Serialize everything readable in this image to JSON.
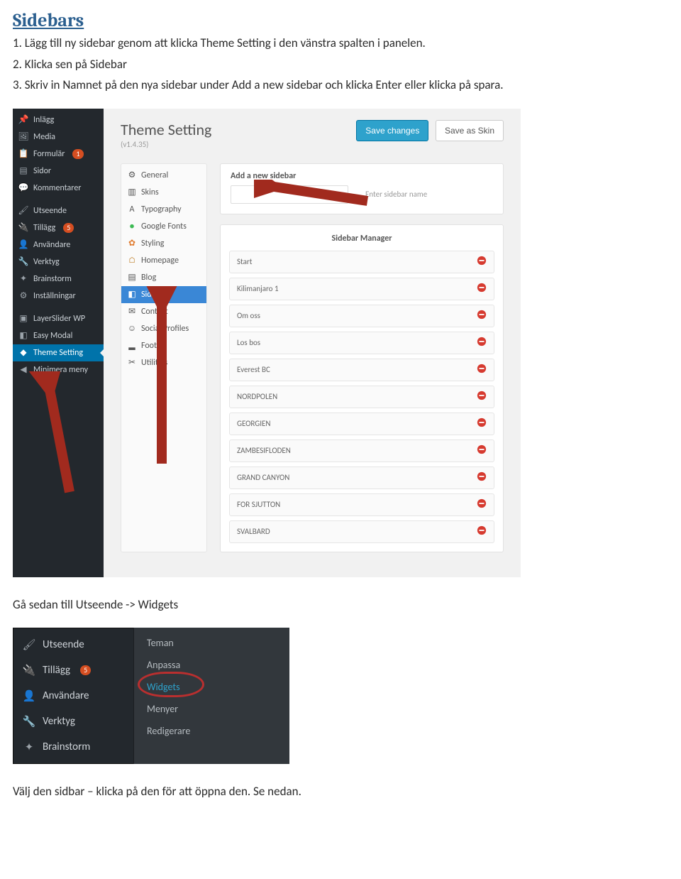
{
  "heading": "Sidebars",
  "steps": {
    "s1": "1. Lägg till ny sidebar genom att klicka Theme Setting i den vänstra spalten i panelen.",
    "s2": "2. Klicka sen på Sidebar",
    "s3": "3. Skriv in Namnet på den nya sidebar under Add a new sidebar och klicka Enter eller klicka på spara."
  },
  "mid_text": "Gå sedan till Utseende -> Widgets",
  "end_text": "Välj den sidbar – klicka på den för att öppna den. Se nedan.",
  "shot1": {
    "wp_menu": [
      {
        "label": "Inlägg",
        "badge": "",
        "icon": "pin"
      },
      {
        "label": "Media",
        "badge": "",
        "icon": "media"
      },
      {
        "label": "Formulär",
        "badge": "1",
        "icon": "form"
      },
      {
        "label": "Sidor",
        "badge": "",
        "icon": "page"
      },
      {
        "label": "Kommentarer",
        "badge": "",
        "icon": "comment"
      },
      {
        "label": "Utseende",
        "badge": "",
        "icon": "brush"
      },
      {
        "label": "Tillägg",
        "badge": "5",
        "icon": "plugin"
      },
      {
        "label": "Användare",
        "badge": "",
        "icon": "user"
      },
      {
        "label": "Verktyg",
        "badge": "",
        "icon": "wrench"
      },
      {
        "label": "Brainstorm",
        "badge": "",
        "icon": "brain"
      },
      {
        "label": "Inställningar",
        "badge": "",
        "icon": "sliders"
      },
      {
        "label": "LayerSlider WP",
        "badge": "",
        "icon": "layers"
      },
      {
        "label": "Easy Modal",
        "badge": "",
        "icon": "modal"
      },
      {
        "label": "Theme Setting",
        "badge": "",
        "icon": "theme",
        "active": true
      },
      {
        "label": "Minimera meny",
        "badge": "",
        "icon": "collapse"
      }
    ],
    "panel_title": "Theme Setting",
    "panel_ver": "(v1.4.35)",
    "btn_save": "Save changes",
    "btn_skin": "Save as Skin",
    "settings_nav": [
      {
        "label": "General",
        "icon": "gear"
      },
      {
        "label": "Skins",
        "icon": "skins"
      },
      {
        "label": "Typography",
        "icon": "font"
      },
      {
        "label": "Google Fonts",
        "icon": "google"
      },
      {
        "label": "Styling",
        "icon": "palette"
      },
      {
        "label": "Homepage",
        "icon": "home"
      },
      {
        "label": "Blog",
        "icon": "blog"
      },
      {
        "label": "Sidebar",
        "icon": "sidebar",
        "active": true
      },
      {
        "label": "Contact",
        "icon": "mail"
      },
      {
        "label": "Social Profiles",
        "icon": "social"
      },
      {
        "label": "Footer",
        "icon": "footer"
      },
      {
        "label": "Utilities",
        "icon": "tools"
      }
    ],
    "add_label": "Add a new sidebar",
    "add_hint": "Enter sidebar name",
    "manager_title": "Sidebar Manager",
    "sidebars": [
      "Start",
      "Kilimanjaro 1",
      "Om oss",
      "Los bos",
      "Everest BC",
      "NORDPOLEN",
      "GEORGIEN",
      "ZAMBESIFLODEN",
      "GRAND CANYON",
      "FOR SJUTTON",
      "SVALBARD"
    ]
  },
  "shot2": {
    "left": [
      {
        "label": "Utseende",
        "icon": "brush"
      },
      {
        "label": "Tillägg",
        "icon": "plugin",
        "badge": "5"
      },
      {
        "label": "Användare",
        "icon": "user"
      },
      {
        "label": "Verktyg",
        "icon": "wrench"
      },
      {
        "label": "Brainstorm",
        "icon": "brain"
      }
    ],
    "right": [
      {
        "label": "Teman"
      },
      {
        "label": "Anpassa"
      },
      {
        "label": "Widgets",
        "active": true
      },
      {
        "label": "Menyer"
      },
      {
        "label": "Redigerare"
      }
    ]
  }
}
